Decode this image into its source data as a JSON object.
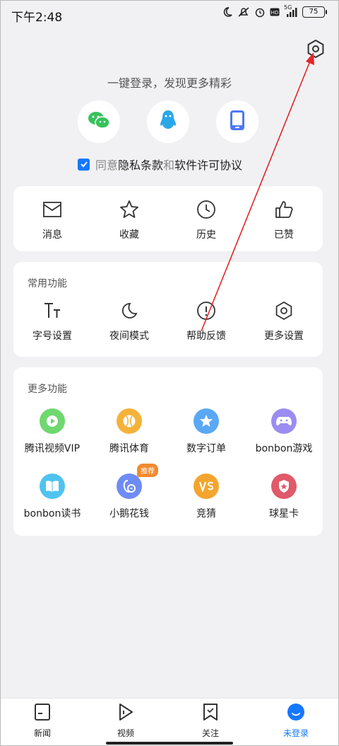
{
  "status_bar": {
    "time": "下午2:48",
    "network": "5G",
    "battery": "75"
  },
  "login": {
    "title": "一键登录，发现更多精彩",
    "methods": [
      {
        "name": "wechat",
        "icon": "wechat-icon"
      },
      {
        "name": "qq",
        "icon": "qq-icon"
      },
      {
        "name": "phone",
        "icon": "phone-icon"
      }
    ],
    "agreement": {
      "checked": true,
      "agree": "同意",
      "privacy": "隐私条款",
      "and": "和",
      "license": "软件许可协议"
    }
  },
  "quick_actions": [
    {
      "label": "消息",
      "icon": "mail-icon"
    },
    {
      "label": "收藏",
      "icon": "star-icon"
    },
    {
      "label": "历史",
      "icon": "clock-icon"
    },
    {
      "label": "已赞",
      "icon": "thumbs-up-icon"
    }
  ],
  "common_functions": {
    "title": "常用功能",
    "items": [
      {
        "label": "字号设置",
        "icon": "font-size-icon"
      },
      {
        "label": "夜间模式",
        "icon": "moon-icon"
      },
      {
        "label": "帮助反馈",
        "icon": "help-icon"
      },
      {
        "label": "更多设置",
        "icon": "settings-icon"
      }
    ]
  },
  "more_functions": {
    "title": "更多功能",
    "items": [
      {
        "label": "腾讯视频VIP",
        "icon": "play-icon",
        "color": "#6fd86f"
      },
      {
        "label": "腾讯体育",
        "icon": "baseball-icon",
        "color": "#f5b23a"
      },
      {
        "label": "数字订单",
        "icon": "star-badge-icon",
        "color": "#5aa8f5"
      },
      {
        "label": "bonbon游戏",
        "icon": "gamepad-icon",
        "color": "#9b8cf2"
      },
      {
        "label": "bonbon读书",
        "icon": "book-icon",
        "color": "#4fc3ef"
      },
      {
        "label": "小鹅花钱",
        "icon": "penguin-coin-icon",
        "color": "#6e8cf5",
        "badge": "推荐"
      },
      {
        "label": "竞猜",
        "icon": "vs-icon",
        "color": "#f4a52e"
      },
      {
        "label": "球星卡",
        "icon": "shield-card-icon",
        "color": "#e05a6a"
      }
    ]
  },
  "bottom_nav": [
    {
      "label": "新闻",
      "icon": "news-icon",
      "active": false
    },
    {
      "label": "视频",
      "icon": "video-icon",
      "active": false
    },
    {
      "label": "关注",
      "icon": "bookmark-icon",
      "active": false
    },
    {
      "label": "未登录",
      "icon": "avatar-icon",
      "active": true
    }
  ],
  "colors": {
    "accent": "#1677ff",
    "background": "#f1f1f3",
    "annotation_arrow": "#e3262a"
  }
}
